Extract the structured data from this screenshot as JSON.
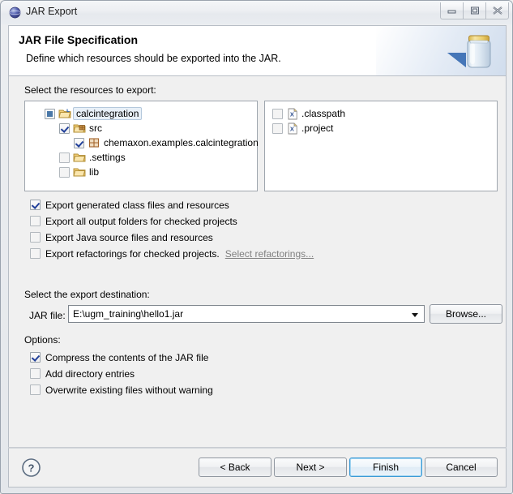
{
  "window": {
    "title": "JAR Export",
    "icon": "eclipse-globe-icon",
    "buttons": {
      "minimize": "Minimize",
      "restore": "Restore",
      "close": "Close"
    }
  },
  "banner": {
    "title": "JAR File Specification",
    "description": "Define which resources should be exported into the JAR.",
    "art": "jar-illustration"
  },
  "resources": {
    "label": "Select the resources to export:",
    "tree": [
      {
        "label": "calcintegration",
        "state": "partial",
        "icon": "project-folder-icon",
        "indent": 0,
        "selected": true
      },
      {
        "label": "src",
        "state": "checked",
        "icon": "source-folder-icon",
        "indent": 1,
        "selected": false
      },
      {
        "label": "chemaxon.examples.calcintegration",
        "state": "checked",
        "icon": "package-icon",
        "indent": 2,
        "selected": false
      },
      {
        "label": ".settings",
        "state": "unchecked",
        "icon": "folder-icon",
        "indent": 1,
        "selected": false
      },
      {
        "label": "lib",
        "state": "unchecked",
        "icon": "folder-icon",
        "indent": 1,
        "selected": false
      }
    ],
    "files": [
      {
        "label": ".classpath",
        "state": "unchecked",
        "icon": "xml-file-icon"
      },
      {
        "label": ".project",
        "state": "unchecked",
        "icon": "xml-file-icon"
      }
    ]
  },
  "export_options": [
    {
      "label": "Export generated class files and resources",
      "state": "checked"
    },
    {
      "label": "Export all output folders for checked projects",
      "state": "unchecked"
    },
    {
      "label": "Export Java source files and resources",
      "state": "unchecked"
    },
    {
      "label": "Export refactorings for checked projects.",
      "state": "unchecked",
      "link": "Select refactorings..."
    }
  ],
  "destination": {
    "label": "Select the export destination:",
    "field_label": "JAR file:",
    "value": "E:\\ugm_training\\hello1.jar",
    "browse_label": "Browse..."
  },
  "options": {
    "label": "Options:",
    "items": [
      {
        "label": "Compress the contents of the JAR file",
        "state": "checked"
      },
      {
        "label": "Add directory entries",
        "state": "unchecked"
      },
      {
        "label": "Overwrite existing files without warning",
        "state": "unchecked"
      }
    ]
  },
  "footer": {
    "help": "help-icon",
    "back": "< Back",
    "next": "Next >",
    "finish": "Finish",
    "cancel": "Cancel",
    "default_button": "Finish"
  },
  "colors": {
    "accent": "#3c9ad6",
    "checkmark": "#21409a",
    "partial_fill": "#4a78a8",
    "folder": "#e8b44b",
    "package": "#b98a4b",
    "disabled_link": "#818181"
  }
}
